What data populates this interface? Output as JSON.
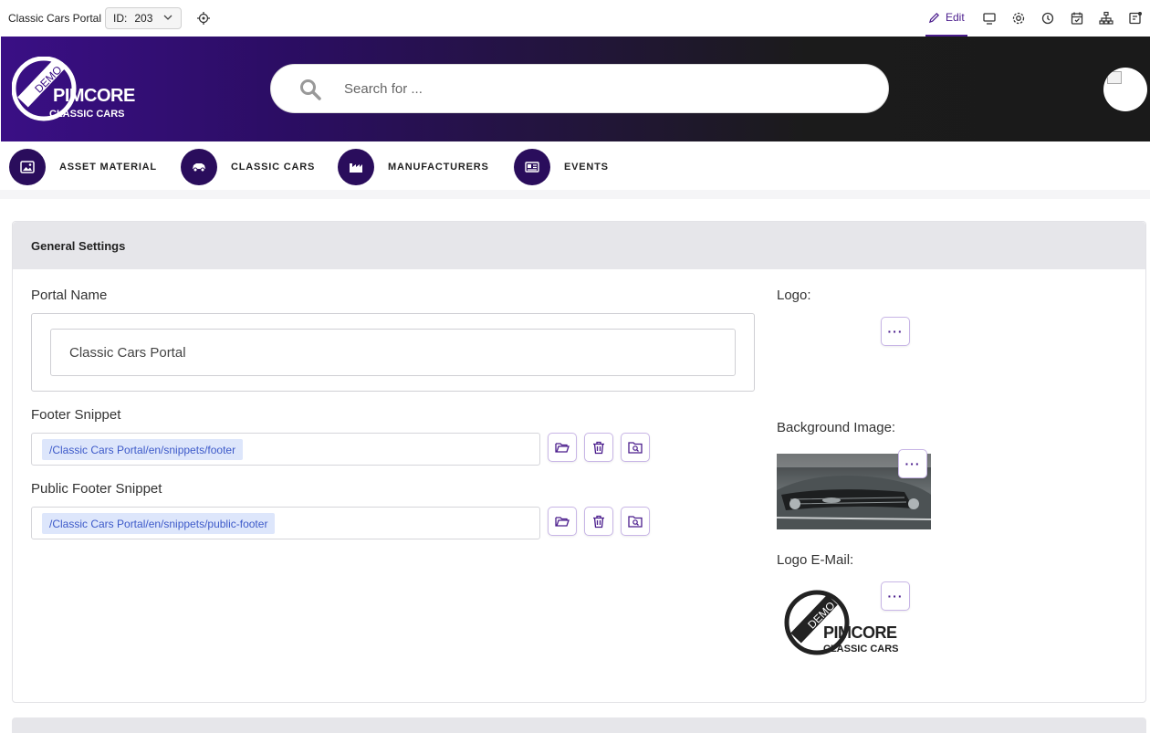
{
  "toolbar": {
    "title": "Classic Cars Portal",
    "id_label": "ID:",
    "id_value": "203",
    "edit_label": "Edit"
  },
  "header": {
    "logo": {
      "badge": "DEMO",
      "brand": "PIMCORE",
      "sub": "CLASSIC CARS"
    },
    "search_placeholder": "Search for ..."
  },
  "nav": {
    "items": [
      {
        "label": "ASSET MATERIAL",
        "icon": "image-icon"
      },
      {
        "label": "CLASSIC CARS",
        "icon": "car-icon"
      },
      {
        "label": "MANUFACTURERS",
        "icon": "factory-icon"
      },
      {
        "label": "EVENTS",
        "icon": "newspaper-icon"
      }
    ]
  },
  "panel": {
    "title": "General Settings",
    "portal_name_label": "Portal Name",
    "portal_name_value": "Classic Cars Portal",
    "footer_snippet_label": "Footer Snippet",
    "footer_snippet_value": "/Classic Cars Portal/en/snippets/footer",
    "public_footer_label": "Public Footer Snippet",
    "public_footer_value": "/Classic Cars Portal/en/snippets/public-footer",
    "logo_label": "Logo:",
    "bg_image_label": "Background Image:",
    "logo_email_label": "Logo E-Mail:",
    "more_label": "···"
  },
  "colors": {
    "accent": "#4a1c8c",
    "nav_circle": "#2a0d5c",
    "path_bg": "#dde6fb",
    "path_text": "#3d5ac9"
  }
}
